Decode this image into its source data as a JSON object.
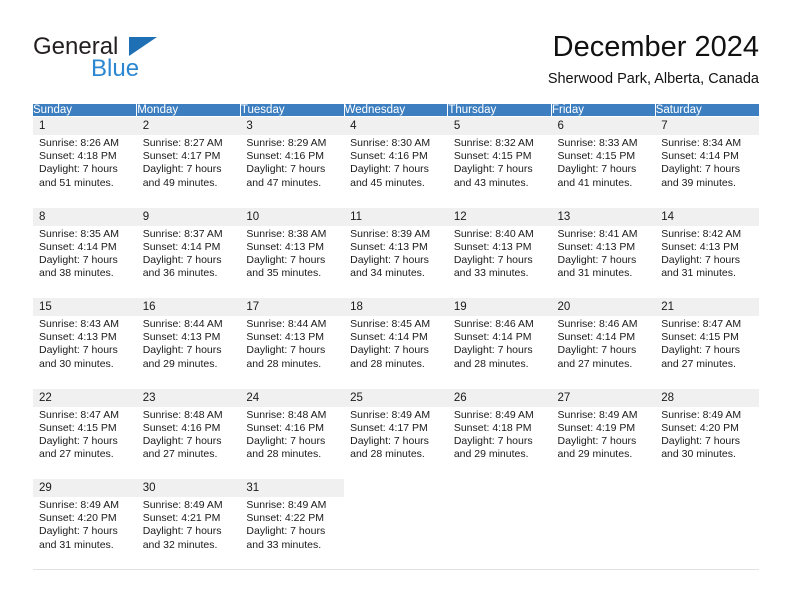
{
  "brand": {
    "name_part1": "General",
    "name_part2": "Blue",
    "triangle_icon": "triangle-icon",
    "accent_color": "#2b87d1",
    "dark_color": "#231f20"
  },
  "header": {
    "month_title": "December 2024",
    "location": "Sherwood Park, Alberta, Canada"
  },
  "calendar": {
    "header_color": "#3c7ebf",
    "daynum_bg": "#f0f0f0",
    "weekday_labels": [
      "Sunday",
      "Monday",
      "Tuesday",
      "Wednesday",
      "Thursday",
      "Friday",
      "Saturday"
    ],
    "weeks": [
      [
        {
          "day": "1",
          "sunrise": "Sunrise: 8:26 AM",
          "sunset": "Sunset: 4:18 PM",
          "daylight1": "Daylight: 7 hours",
          "daylight2": "and 51 minutes."
        },
        {
          "day": "2",
          "sunrise": "Sunrise: 8:27 AM",
          "sunset": "Sunset: 4:17 PM",
          "daylight1": "Daylight: 7 hours",
          "daylight2": "and 49 minutes."
        },
        {
          "day": "3",
          "sunrise": "Sunrise: 8:29 AM",
          "sunset": "Sunset: 4:16 PM",
          "daylight1": "Daylight: 7 hours",
          "daylight2": "and 47 minutes."
        },
        {
          "day": "4",
          "sunrise": "Sunrise: 8:30 AM",
          "sunset": "Sunset: 4:16 PM",
          "daylight1": "Daylight: 7 hours",
          "daylight2": "and 45 minutes."
        },
        {
          "day": "5",
          "sunrise": "Sunrise: 8:32 AM",
          "sunset": "Sunset: 4:15 PM",
          "daylight1": "Daylight: 7 hours",
          "daylight2": "and 43 minutes."
        },
        {
          "day": "6",
          "sunrise": "Sunrise: 8:33 AM",
          "sunset": "Sunset: 4:15 PM",
          "daylight1": "Daylight: 7 hours",
          "daylight2": "and 41 minutes."
        },
        {
          "day": "7",
          "sunrise": "Sunrise: 8:34 AM",
          "sunset": "Sunset: 4:14 PM",
          "daylight1": "Daylight: 7 hours",
          "daylight2": "and 39 minutes."
        }
      ],
      [
        {
          "day": "8",
          "sunrise": "Sunrise: 8:35 AM",
          "sunset": "Sunset: 4:14 PM",
          "daylight1": "Daylight: 7 hours",
          "daylight2": "and 38 minutes."
        },
        {
          "day": "9",
          "sunrise": "Sunrise: 8:37 AM",
          "sunset": "Sunset: 4:14 PM",
          "daylight1": "Daylight: 7 hours",
          "daylight2": "and 36 minutes."
        },
        {
          "day": "10",
          "sunrise": "Sunrise: 8:38 AM",
          "sunset": "Sunset: 4:13 PM",
          "daylight1": "Daylight: 7 hours",
          "daylight2": "and 35 minutes."
        },
        {
          "day": "11",
          "sunrise": "Sunrise: 8:39 AM",
          "sunset": "Sunset: 4:13 PM",
          "daylight1": "Daylight: 7 hours",
          "daylight2": "and 34 minutes."
        },
        {
          "day": "12",
          "sunrise": "Sunrise: 8:40 AM",
          "sunset": "Sunset: 4:13 PM",
          "daylight1": "Daylight: 7 hours",
          "daylight2": "and 33 minutes."
        },
        {
          "day": "13",
          "sunrise": "Sunrise: 8:41 AM",
          "sunset": "Sunset: 4:13 PM",
          "daylight1": "Daylight: 7 hours",
          "daylight2": "and 31 minutes."
        },
        {
          "day": "14",
          "sunrise": "Sunrise: 8:42 AM",
          "sunset": "Sunset: 4:13 PM",
          "daylight1": "Daylight: 7 hours",
          "daylight2": "and 31 minutes."
        }
      ],
      [
        {
          "day": "15",
          "sunrise": "Sunrise: 8:43 AM",
          "sunset": "Sunset: 4:13 PM",
          "daylight1": "Daylight: 7 hours",
          "daylight2": "and 30 minutes."
        },
        {
          "day": "16",
          "sunrise": "Sunrise: 8:44 AM",
          "sunset": "Sunset: 4:13 PM",
          "daylight1": "Daylight: 7 hours",
          "daylight2": "and 29 minutes."
        },
        {
          "day": "17",
          "sunrise": "Sunrise: 8:44 AM",
          "sunset": "Sunset: 4:13 PM",
          "daylight1": "Daylight: 7 hours",
          "daylight2": "and 28 minutes."
        },
        {
          "day": "18",
          "sunrise": "Sunrise: 8:45 AM",
          "sunset": "Sunset: 4:14 PM",
          "daylight1": "Daylight: 7 hours",
          "daylight2": "and 28 minutes."
        },
        {
          "day": "19",
          "sunrise": "Sunrise: 8:46 AM",
          "sunset": "Sunset: 4:14 PM",
          "daylight1": "Daylight: 7 hours",
          "daylight2": "and 28 minutes."
        },
        {
          "day": "20",
          "sunrise": "Sunrise: 8:46 AM",
          "sunset": "Sunset: 4:14 PM",
          "daylight1": "Daylight: 7 hours",
          "daylight2": "and 27 minutes."
        },
        {
          "day": "21",
          "sunrise": "Sunrise: 8:47 AM",
          "sunset": "Sunset: 4:15 PM",
          "daylight1": "Daylight: 7 hours",
          "daylight2": "and 27 minutes."
        }
      ],
      [
        {
          "day": "22",
          "sunrise": "Sunrise: 8:47 AM",
          "sunset": "Sunset: 4:15 PM",
          "daylight1": "Daylight: 7 hours",
          "daylight2": "and 27 minutes."
        },
        {
          "day": "23",
          "sunrise": "Sunrise: 8:48 AM",
          "sunset": "Sunset: 4:16 PM",
          "daylight1": "Daylight: 7 hours",
          "daylight2": "and 27 minutes."
        },
        {
          "day": "24",
          "sunrise": "Sunrise: 8:48 AM",
          "sunset": "Sunset: 4:16 PM",
          "daylight1": "Daylight: 7 hours",
          "daylight2": "and 28 minutes."
        },
        {
          "day": "25",
          "sunrise": "Sunrise: 8:49 AM",
          "sunset": "Sunset: 4:17 PM",
          "daylight1": "Daylight: 7 hours",
          "daylight2": "and 28 minutes."
        },
        {
          "day": "26",
          "sunrise": "Sunrise: 8:49 AM",
          "sunset": "Sunset: 4:18 PM",
          "daylight1": "Daylight: 7 hours",
          "daylight2": "and 29 minutes."
        },
        {
          "day": "27",
          "sunrise": "Sunrise: 8:49 AM",
          "sunset": "Sunset: 4:19 PM",
          "daylight1": "Daylight: 7 hours",
          "daylight2": "and 29 minutes."
        },
        {
          "day": "28",
          "sunrise": "Sunrise: 8:49 AM",
          "sunset": "Sunset: 4:20 PM",
          "daylight1": "Daylight: 7 hours",
          "daylight2": "and 30 minutes."
        }
      ],
      [
        {
          "day": "29",
          "sunrise": "Sunrise: 8:49 AM",
          "sunset": "Sunset: 4:20 PM",
          "daylight1": "Daylight: 7 hours",
          "daylight2": "and 31 minutes."
        },
        {
          "day": "30",
          "sunrise": "Sunrise: 8:49 AM",
          "sunset": "Sunset: 4:21 PM",
          "daylight1": "Daylight: 7 hours",
          "daylight2": "and 32 minutes."
        },
        {
          "day": "31",
          "sunrise": "Sunrise: 8:49 AM",
          "sunset": "Sunset: 4:22 PM",
          "daylight1": "Daylight: 7 hours",
          "daylight2": "and 33 minutes."
        },
        {
          "day": "",
          "sunrise": "",
          "sunset": "",
          "daylight1": "",
          "daylight2": ""
        },
        {
          "day": "",
          "sunrise": "",
          "sunset": "",
          "daylight1": "",
          "daylight2": ""
        },
        {
          "day": "",
          "sunrise": "",
          "sunset": "",
          "daylight1": "",
          "daylight2": ""
        },
        {
          "day": "",
          "sunrise": "",
          "sunset": "",
          "daylight1": "",
          "daylight2": ""
        }
      ]
    ]
  }
}
